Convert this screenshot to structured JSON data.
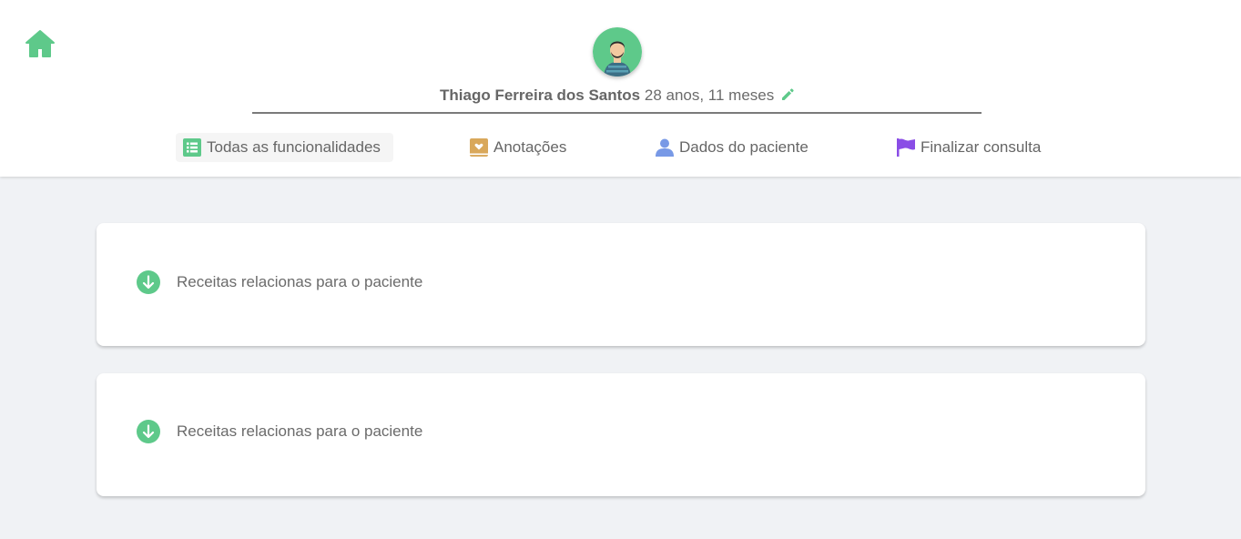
{
  "header": {
    "patient": {
      "name": "Thiago Ferreira dos Santos",
      "age": "28 anos, 11 meses"
    },
    "icons": {
      "home": "home-icon",
      "avatar": "male-avatar-icon",
      "edit": "pencil-icon"
    }
  },
  "nav": {
    "items": [
      {
        "label": "Todas as funcionalidades",
        "icon": "list-icon",
        "color": "#5ec98a",
        "active": true
      },
      {
        "label": "Anotações",
        "icon": "notebook-heart-icon",
        "color": "#d9a85b"
      },
      {
        "label": "Dados do paciente",
        "icon": "user-icon",
        "color": "#7899e6"
      },
      {
        "label": "Finalizar consulta",
        "icon": "flag-icon",
        "color": "#8a4de6"
      }
    ]
  },
  "sections": [
    {
      "label": "Receitas relacionas para o paciente",
      "icon": "arrow-down-circle-icon"
    },
    {
      "label": "Receitas relacionas para o paciente",
      "icon": "arrow-down-circle-icon"
    }
  ],
  "colors": {
    "accent_green": "#5ec98a",
    "background": "#f0f2f5",
    "text": "#6b6b6b"
  }
}
